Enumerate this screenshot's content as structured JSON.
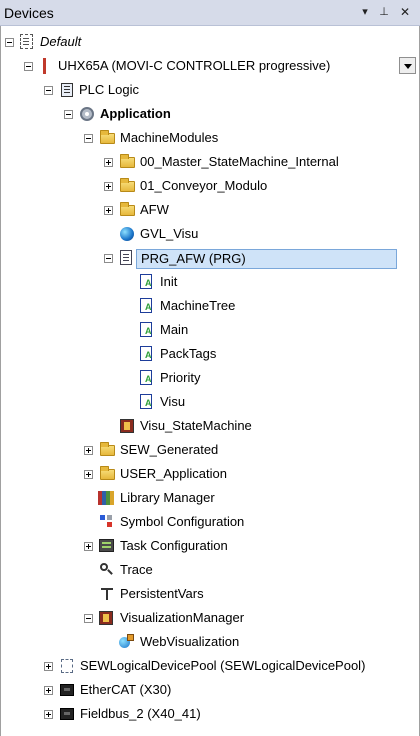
{
  "window": {
    "title": "Devices",
    "buttons": {
      "dropdown": "▾",
      "pin": "⊥",
      "close": "✕"
    }
  },
  "tree": [
    {
      "id": "default",
      "label": "Default",
      "icon": "default-device-icon",
      "expander": "minus",
      "style": "italic"
    },
    {
      "id": "uhx65a",
      "label": "UHX65A (MOVI-C CONTROLLER progressive)",
      "icon": "controller-icon",
      "expander": "minus"
    },
    {
      "id": "plc-logic",
      "label": "PLC Logic",
      "icon": "plc-logic-icon",
      "expander": "minus"
    },
    {
      "id": "application",
      "label": "Application",
      "icon": "application-gear-icon",
      "expander": "minus",
      "style": "bold"
    },
    {
      "id": "machine-modules",
      "label": "MachineModules",
      "icon": "folder-icon",
      "expander": "minus"
    },
    {
      "id": "master-state",
      "label": "00_Master_StateMachine_Internal",
      "icon": "folder-icon",
      "expander": "plus"
    },
    {
      "id": "conveyor",
      "label": "01_Conveyor_Modulo",
      "icon": "folder-icon",
      "expander": "plus"
    },
    {
      "id": "afw",
      "label": "AFW",
      "icon": "folder-icon",
      "expander": "plus"
    },
    {
      "id": "gvl-visu",
      "label": "GVL_Visu",
      "icon": "globe-icon",
      "expander": "none"
    },
    {
      "id": "prg-afw",
      "label": "PRG_AFW (PRG)",
      "icon": "program-icon",
      "expander": "minus",
      "selected": true
    },
    {
      "id": "init",
      "label": "Init",
      "icon": "action-icon",
      "expander": "none"
    },
    {
      "id": "machine-tree",
      "label": "MachineTree",
      "icon": "action-icon",
      "expander": "none"
    },
    {
      "id": "main",
      "label": "Main",
      "icon": "action-icon",
      "expander": "none"
    },
    {
      "id": "pack-tags",
      "label": "PackTags",
      "icon": "action-icon",
      "expander": "none"
    },
    {
      "id": "priority",
      "label": "Priority",
      "icon": "action-icon",
      "expander": "none"
    },
    {
      "id": "visu",
      "label": "Visu",
      "icon": "action-icon",
      "expander": "none"
    },
    {
      "id": "visu-statemachine",
      "label": "Visu_StateMachine",
      "icon": "visualization-icon",
      "expander": "none"
    },
    {
      "id": "sew-generated",
      "label": "SEW_Generated",
      "icon": "folder-icon",
      "expander": "plus"
    },
    {
      "id": "user-application",
      "label": "USER_Application",
      "icon": "folder-icon",
      "expander": "plus"
    },
    {
      "id": "library-manager",
      "label": "Library Manager",
      "icon": "library-icon",
      "expander": "none"
    },
    {
      "id": "symbol-config",
      "label": "Symbol Configuration",
      "icon": "symbol-config-icon",
      "expander": "none"
    },
    {
      "id": "task-config",
      "label": "Task Configuration",
      "icon": "task-config-icon",
      "expander": "plus"
    },
    {
      "id": "trace",
      "label": "Trace",
      "icon": "trace-icon",
      "expander": "none"
    },
    {
      "id": "persistent-vars",
      "label": "PersistentVars",
      "icon": "persistent-vars-icon",
      "expander": "none"
    },
    {
      "id": "visualization-manager",
      "label": "VisualizationManager",
      "icon": "visualization-manager-icon",
      "expander": "minus"
    },
    {
      "id": "web-visualization",
      "label": "WebVisualization",
      "icon": "web-visualization-icon",
      "expander": "none"
    },
    {
      "id": "sew-logical-pool",
      "label": "SEWLogicalDevicePool (SEWLogicalDevicePool)",
      "icon": "logical-device-pool-icon",
      "expander": "plus"
    },
    {
      "id": "ethercat",
      "label": "EtherCAT (X30)",
      "icon": "network-device-icon",
      "expander": "plus"
    },
    {
      "id": "fieldbus2",
      "label": "Fieldbus_2 (X40_41)",
      "icon": "network-device-icon",
      "expander": "plus"
    }
  ],
  "colors": {
    "titlebar_bg": "#d6dbe9",
    "selection_bg": "#cfe3f8",
    "selection_border": "#7aa7da"
  }
}
